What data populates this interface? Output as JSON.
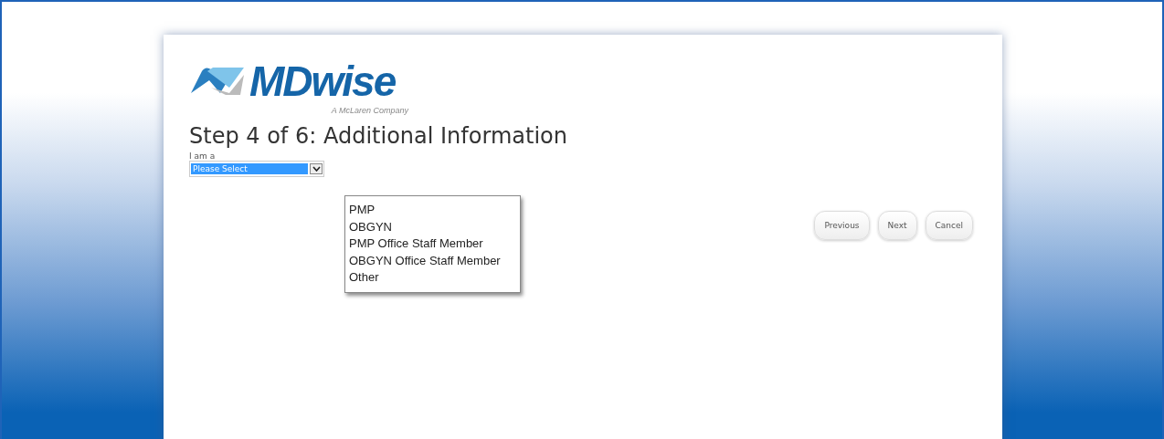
{
  "logo": {
    "name": "MDwise",
    "tagline": "A McLaren Company"
  },
  "title": "Step 4 of 6: Additional Information",
  "field": {
    "label": "I am a",
    "value": "Please Select"
  },
  "dropdown_options": [
    {
      "label": "PMP"
    },
    {
      "label": "OBGYN"
    },
    {
      "label": "PMP Office Staff Member"
    },
    {
      "label": "OBGYN Office Staff Member"
    },
    {
      "label": "Other"
    }
  ],
  "buttons": [
    "Previous",
    "Next",
    "Cancel"
  ]
}
